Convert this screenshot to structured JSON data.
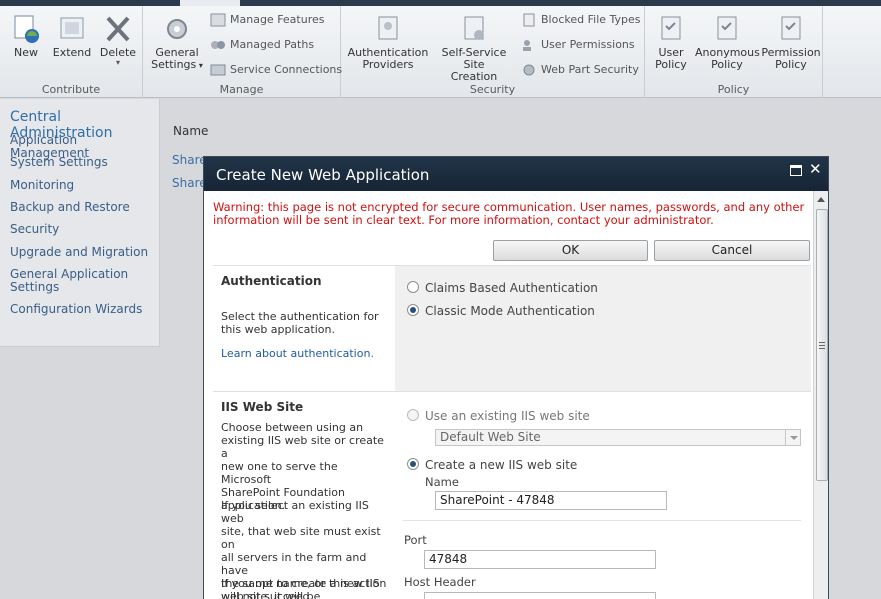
{
  "ribbon": {
    "contribute": {
      "label": "Contribute",
      "new": "New",
      "extend": "Extend",
      "delete": "Delete"
    },
    "manage": {
      "label": "Manage",
      "general_settings_1": "General",
      "general_settings_2": "Settings",
      "manage_features": "Manage Features",
      "managed_paths": "Managed Paths",
      "service_connections": "Service Connections"
    },
    "security": {
      "label": "Security",
      "auth_providers_1": "Authentication",
      "auth_providers_2": "Providers",
      "self_service_1": "Self-Service Site",
      "self_service_2": "Creation",
      "blocked_file_types": "Blocked File Types",
      "user_permissions": "User Permissions",
      "web_part_security": "Web Part Security"
    },
    "policy": {
      "label": "Policy",
      "user_policy_1": "User",
      "user_policy_2": "Policy",
      "anon_policy_1": "Anonymous",
      "anon_policy_2": "Policy",
      "perm_policy_1": "Permission",
      "perm_policy_2": "Policy"
    }
  },
  "leftnav": {
    "heading": "Central Administration",
    "items": [
      "Application Management",
      "System Settings",
      "Monitoring",
      "Backup and Restore",
      "Security",
      "Upgrade and Migration",
      "General Application",
      "Settings",
      "Configuration Wizards"
    ]
  },
  "background": {
    "column_header": "Name",
    "link1": "Share",
    "link2": "Share"
  },
  "dialog": {
    "title": "Create New Web Application",
    "warning_line1": "Warning: this page is not encrypted for secure communication. User names, passwords, and any other",
    "warning_line2": "information will be sent in clear text. For more information, contact your administrator.",
    "ok": "OK",
    "cancel": "Cancel",
    "auth": {
      "title": "Authentication",
      "desc_line1": "Select the authentication for",
      "desc_line2": "this web application.",
      "learn_more": "Learn about authentication.",
      "option_claims": "Claims Based Authentication",
      "option_classic": "Classic Mode Authentication",
      "selected": "Classic Mode Authentication"
    },
    "iis": {
      "title": "IIS Web Site",
      "desc1": [
        "Choose between using an",
        "existing IIS web site or create a",
        "new one to serve the Microsoft",
        "SharePoint Foundation",
        "application."
      ],
      "desc2": [
        "If you select an existing IIS web",
        "site, that web site must exist on",
        "all servers in the farm and have",
        "the same name, or this action",
        "will not succeed."
      ],
      "desc3": [
        "If you opt to create a new IIS",
        "web site, it will be automatically"
      ],
      "option_existing": "Use an existing IIS web site",
      "existing_value": "Default Web Site",
      "option_new": "Create a new IIS web site",
      "name_label": "Name",
      "name_value": "SharePoint - 47848",
      "port_label": "Port",
      "port_value": "47848",
      "host_header_label": "Host Header",
      "host_header_value": ""
    }
  }
}
